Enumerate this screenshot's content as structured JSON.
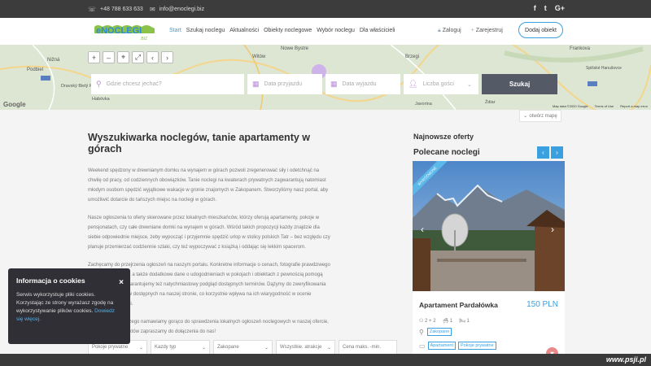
{
  "topbar": {
    "phone": "+48 788 633 633",
    "email": "info@enoclegi.biz",
    "social": [
      "f",
      "t",
      "G+"
    ]
  },
  "header": {
    "logo_text": "eNOCLEGI",
    "logo_sub": ".BIZ",
    "nav": [
      "Start",
      "Szukaj noclegu",
      "Aktualności",
      "Obiekty noclegowe",
      "Wybór noclegu",
      "Dla właścicieli"
    ],
    "login": "Zaloguj",
    "register": "Zarejestruj",
    "add_object": "Dodaj obiekt"
  },
  "map": {
    "controls": [
      "+",
      "–",
      "⌖",
      "⤢",
      "‹",
      "›"
    ],
    "places": [
      "Podbiel",
      "Nižná",
      "Dravský Bielý Potok",
      "Witów",
      "Nowe Bystre",
      "Brzegi",
      "Habóvka",
      "Frankova",
      "Spišské Hanušovce",
      "Javorina",
      "Ždiar"
    ],
    "google": "Google",
    "footer": [
      "Map data ©2020 Google",
      "Terms of Use",
      "Report a map error"
    ],
    "open_map": "otwórz mapę"
  },
  "search": {
    "where_placeholder": "Gdzie chcesz jechać?",
    "date_from": "Data przyjazdu",
    "date_to": "Data wyjazdu",
    "guests": "Liczba gości",
    "button": "Szukaj"
  },
  "main": {
    "title": "Wyszukiwarka noclegów, tanie apartamenty w górach",
    "p1": "Weekend spędzony w drewnianym domku na wynajem w górach pozwoli zregenerować siły i odetchnąć na chwilę od pracy, od codziennych obowiązków. Tanie noclegi na kwaterach prywatnych zagwarantują natomiast młodym osobom spędzić wyjątkowe wakacje w gronie znajomych w Zakopanem. Stworzyliśmy nasz portal, aby umożliwić dotarcie do tańszych miejsc na noclegi w górach.",
    "p2": "Nasze ogłoszenia to oferty skierowane przez lokalnych mieszkańców, którzy oferują apartamenty, pokoje w pensjonatach, czy całe drewniane domki na wynajem w górach. Wśród takich propozycji każdy znajdzie dla siebie odpowiednie miejsce, żeby wypocząć i przyjemnie spędzić urlop w stolicy polskich Tatr – bez względu czy planuje przemierzać codziennie szlaki, czy też wypoczywać z książką i oddając się lekkim spacerom.",
    "p3": "Zachęcamy do przejrzenia ogłoszeń na naszym portalu. Konkretne informacje o cenach, fotografie prawdziwego stanu wyposażenia, a także dodatkowe dane o udogodnieniach w pokojach i obiektach z pewnością pomogą podjąć decyzję. Gwarantujemy też natychmiastowy podgląd dostępnych terminów. Dążymy do zweryfikowania wszystkich obiektów dostępnych na naszej stronie, co korzystnie wpływa na ich wiarygodność w ocenie potencjalnych Gości.",
    "p4": "Przekonaj się, dlaczego namawiamy gorąco do sprawdzenia lokalnych ogłoszeń noclegowych w naszej ofercie, zaś właścicieli obiektów zapraszamy do dołączenia do nas!"
  },
  "filters": [
    "Pokoje prywatne",
    "Kazdy typ",
    "Zakopane",
    "Wszystkie. atrakcje",
    "Cena maks. -min."
  ],
  "sidebar": {
    "newest": "Najnowsze oferty",
    "recommended": "Polecane noclegi",
    "card": {
      "ribbon": "WYRÓŻNIONE",
      "title": "Apartament Pardałówka",
      "price": "150 PLN",
      "persons": "2 + 2",
      "bathrooms": "1",
      "beds": "1",
      "location": "Zakopane",
      "tags": [
        "Apartament",
        "Pokoje prywatne"
      ]
    }
  },
  "cookie": {
    "title": "Informacja o cookies",
    "text": "Serwis wykorzystuje pliki cookies. Korzystając ze strony wyrażasz zgodę na wykorzystywanie plików cookies.",
    "link": "Dowiedz się więcej.",
    "close": "×"
  },
  "watermark": "www.psji.pl",
  "colors": {
    "accent": "#3aa0e0",
    "search_button": "#545b66",
    "cookie_bg": "#2f2f35"
  }
}
